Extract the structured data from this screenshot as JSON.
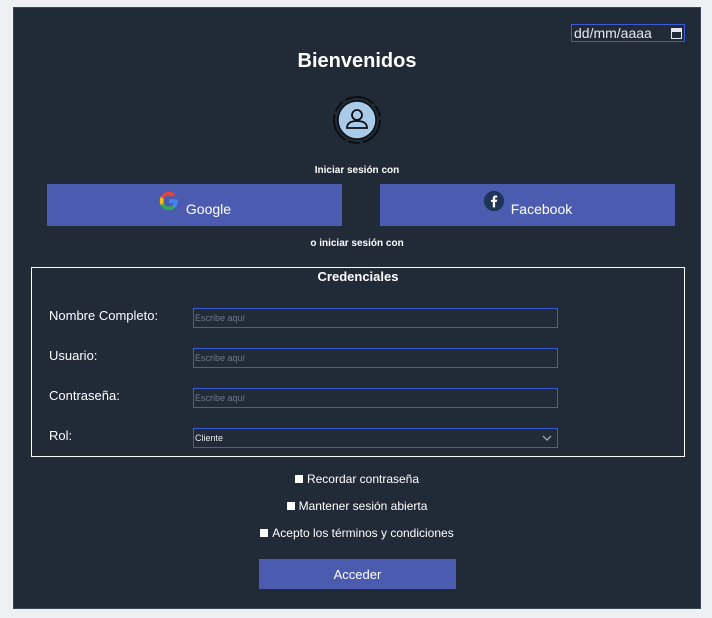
{
  "date_input": {
    "placeholder": "dd/mm/aaaa",
    "icon": "calendar-icon"
  },
  "header": {
    "title": "Bienvenidos",
    "avatar_icon": "user-icon"
  },
  "social": {
    "label": "Iniciar sesión con",
    "google": {
      "label": "Google",
      "icon": "google-icon"
    },
    "facebook": {
      "label": "Facebook",
      "icon": "facebook-icon"
    },
    "alt_label": "o iniciar sesión con"
  },
  "credentials": {
    "legend": "Credenciales",
    "fields": [
      {
        "label": "Nombre Completo:",
        "placeholder": "Escribe aquí"
      },
      {
        "label": "Usuario:",
        "placeholder": "Escribe aquí"
      },
      {
        "label": "Contraseña:",
        "placeholder": "Escribe aquí"
      }
    ],
    "role": {
      "label": "Rol:",
      "value": "Cliente"
    }
  },
  "options": {
    "remember": "Recordar contraseña",
    "keep_session": "Mantener sesión abierta",
    "terms": "Acepto los términos y condiciones"
  },
  "submit": {
    "label": "Acceder"
  },
  "colors": {
    "background": "#212b38",
    "accent": "#4b5cb0",
    "input_border": "#3b5bd6"
  }
}
